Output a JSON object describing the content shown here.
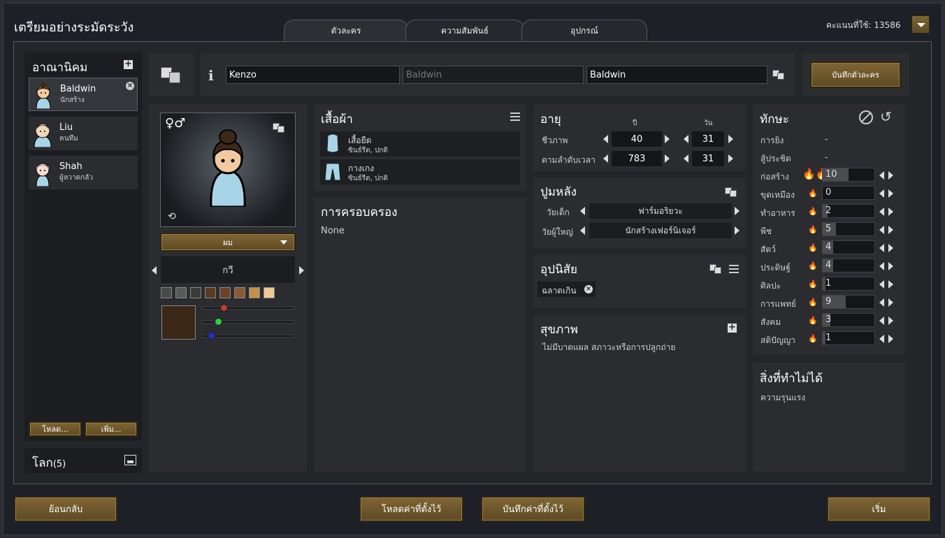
{
  "window": {
    "title": "เตรียมอย่างระมัดระวัง",
    "points": "คะแนนที่ใช้: 13586"
  },
  "tabs": [
    {
      "label": "ตัวละคร"
    },
    {
      "label": "ความสัมพันธ์"
    },
    {
      "label": "อุปกรณ์"
    }
  ],
  "colony": {
    "title": "อาณานิคม",
    "pawns": [
      {
        "name": "Baldwin",
        "role": "นักสร้าง"
      },
      {
        "name": "Liu",
        "role": "คนทึม"
      },
      {
        "name": "Shah",
        "role": "ผู้หวาดกลัว"
      }
    ],
    "load_label": "โหลด...",
    "add_label": "เพิ่ม...",
    "world_label": "โลก",
    "world_count": "(5)"
  },
  "name": {
    "first": "Kenzo",
    "nick_placeholder": "Baldwin",
    "last": "Baldwin",
    "save_label": "บันทึกตัวละคร"
  },
  "appearance": {
    "hair_label": "ผม",
    "hair_style": "กวี",
    "skin_colors": [
      "#4a4a4a",
      "#5a5a5a",
      "#3a3a3a",
      "#5c3a20",
      "#6b4428",
      "#8a5a34",
      "#c49050",
      "#f0c894"
    ],
    "selected_color": "#3b2817",
    "slider_colors": [
      "#c0392b",
      "#2ecc40",
      "#2030c0"
    ],
    "slider_values": [
      0.23,
      0.17,
      0.1
    ]
  },
  "apparel": {
    "title": "เสื้อผ้า",
    "items": [
      {
        "name": "เสื้อยืด",
        "detail": "ซินธ์รีด, ปกติ"
      },
      {
        "name": "กางเกง",
        "detail": "ซินธ์รีด, ปกติ"
      }
    ]
  },
  "ideo": {
    "title": "การครอบครอง",
    "value": "None"
  },
  "age": {
    "title": "อายุ",
    "col_year": "ปี",
    "col_day": "วัน",
    "bio_label": "ชีวภาพ",
    "bio_years": "40",
    "bio_days": "31",
    "chrono_label": "ตามลำดับเวลา",
    "chrono_years": "783",
    "chrono_days": "31"
  },
  "backstory": {
    "title": "ปูมหลัง",
    "child_label": "วัยเด็ก",
    "child_value": "ฟาร์มอริยวะ",
    "adult_label": "วัยผู้ใหญ่",
    "adult_value": "นักสร้างเฟอร์นิเจอร์"
  },
  "traits": {
    "title": "อุปนิสัย",
    "items": [
      "ฉลาดเกิน"
    ]
  },
  "health": {
    "title": "สุขภาพ",
    "text": "ไม่มีบาดแผล สภาวะหรือการปลูกถ่าย"
  },
  "skills": {
    "title": "ทักษะ",
    "items": [
      {
        "label": "การยิง",
        "value": "-",
        "level": 0,
        "passion": 0
      },
      {
        "label": "สู้ประชิด",
        "value": "-",
        "level": 0,
        "passion": 0
      },
      {
        "label": "ก่อสร้าง",
        "value": "10",
        "level": 10,
        "passion": 2
      },
      {
        "label": "ขุดเหมือง",
        "value": "0",
        "level": 0,
        "passion": 0
      },
      {
        "label": "ทำอาหาร",
        "value": "2",
        "level": 2,
        "passion": 0
      },
      {
        "label": "พืช",
        "value": "5",
        "level": 5,
        "passion": 1
      },
      {
        "label": "สัตว์",
        "value": "4",
        "level": 4,
        "passion": 0
      },
      {
        "label": "ประดิษฐ์",
        "value": "4",
        "level": 4,
        "passion": 0
      },
      {
        "label": "ศิลปะ",
        "value": "1",
        "level": 1,
        "passion": 0
      },
      {
        "label": "การแพทย์",
        "value": "9",
        "level": 9,
        "passion": 1
      },
      {
        "label": "สังคม",
        "value": "3",
        "level": 3,
        "passion": 0
      },
      {
        "label": "สติปัญญา",
        "value": "1",
        "level": 1,
        "passion": 0
      }
    ]
  },
  "incapable": {
    "title": "สิ่งที่ทำไม่ได้",
    "items": [
      "ความรุนแรง"
    ]
  },
  "footer": {
    "back": "ย้อนกลับ",
    "load_preset": "โหลดค่าที่ตั้งไว้",
    "save_preset": "บันทึกค่าที่ตั้งไว้",
    "start": "เริ่ม"
  }
}
